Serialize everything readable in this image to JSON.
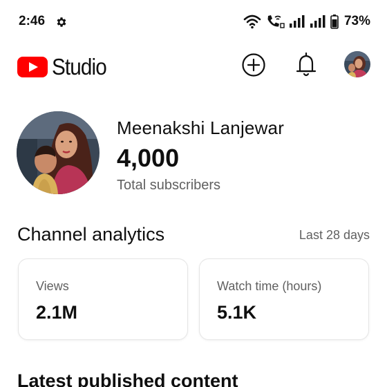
{
  "status_bar": {
    "time": "2:46",
    "battery": "73%",
    "icons": [
      "gear-icon",
      "wifi-icon",
      "wifi-calling-icon",
      "signal-icon",
      "signal-icon",
      "battery-icon"
    ]
  },
  "app_bar": {
    "logo_text": "Studio",
    "brand_color": "#ff0000",
    "icons": [
      "youtube-logo-icon",
      "create-icon",
      "notifications-bell-icon",
      "account-avatar"
    ]
  },
  "channel": {
    "name": "Meenakshi Lanjewar",
    "subscriber_count": "4,000",
    "subscriber_label": "Total subscribers"
  },
  "analytics": {
    "title": "Channel analytics",
    "range": "Last 28 days",
    "cards": [
      {
        "label": "Views",
        "value": "2.1M"
      },
      {
        "label": "Watch time (hours)",
        "value": "5.1K"
      }
    ]
  },
  "latest": {
    "title": "Latest published content"
  }
}
